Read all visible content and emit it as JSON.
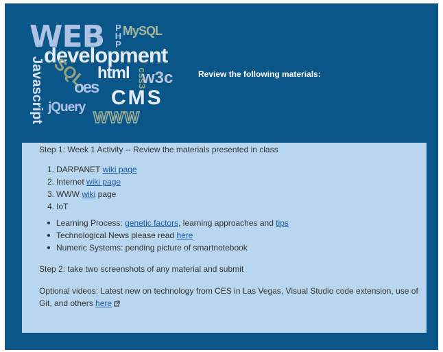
{
  "banner": {
    "words": {
      "web": "WEB",
      "php": "PHP",
      "mysql": "MySQL",
      "development": "development",
      "javascript": "Javascript",
      "sql": "SQL",
      "html": "html",
      "css3": "css3",
      "w3c": "w3c",
      "oes": "oes",
      "cms": "CMS",
      "jquery": "jQuery",
      "www": "WWW"
    },
    "review_text": "Review the following materials:"
  },
  "panel": {
    "step1": "Step 1: Week 1 Activity -- Review the materials presented in class",
    "numbered": [
      {
        "n": "1.",
        "text": "DARPANET ",
        "link": "wiki page",
        "after": ""
      },
      {
        "n": "2.",
        "text": "Internet ",
        "link": "wiki page",
        "after": ""
      },
      {
        "n": "3.",
        "text": "WWW ",
        "link": "wiki",
        "after": " page"
      },
      {
        "n": "4.",
        "text": "IoT",
        "link": "",
        "after": ""
      }
    ],
    "bullets": [
      {
        "text": "Learning Process: ",
        "link1": "genetic factors",
        "mid": ", learning approaches and ",
        "link2": "tips"
      },
      {
        "text": "Technological News please read ",
        "link1": "here"
      },
      {
        "text": "Numeric Systems: pending picture of smartnotebook"
      }
    ],
    "step2": "Step 2: take two screenshots of any material and submit",
    "optional_text": "Optional videos: Latest new on technology from CES in Las Vegas, Visual Studio code extension, use of Git, and others ",
    "optional_link": "here"
  }
}
